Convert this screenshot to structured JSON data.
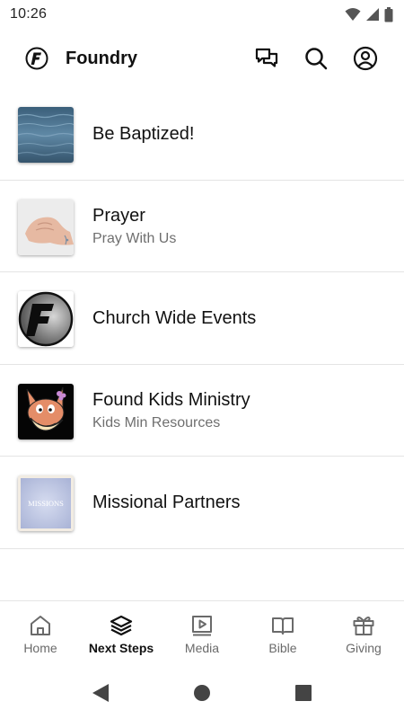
{
  "status_bar": {
    "time": "10:26"
  },
  "header": {
    "app_title": "Foundry"
  },
  "list_items": [
    {
      "title": "Be Baptized!",
      "subtitle": ""
    },
    {
      "title": "Prayer",
      "subtitle": "Pray With Us"
    },
    {
      "title": "Church Wide Events",
      "subtitle": ""
    },
    {
      "title": "Found Kids Ministry",
      "subtitle": "Kids Min Resources"
    },
    {
      "title": "Missional Partners",
      "subtitle": "",
      "thumb_text": "MISSIONS"
    }
  ],
  "bottom_nav": [
    {
      "label": "Home",
      "icon": "home-icon"
    },
    {
      "label": "Next Steps",
      "icon": "layers-icon",
      "active": true
    },
    {
      "label": "Media",
      "icon": "media-icon"
    },
    {
      "label": "Bible",
      "icon": "book-icon"
    },
    {
      "label": "Giving",
      "icon": "gift-icon"
    }
  ],
  "colors": {
    "text": "#111111",
    "muted": "#6f6f6f",
    "divider": "#e4e4e4",
    "background": "#ffffff"
  }
}
